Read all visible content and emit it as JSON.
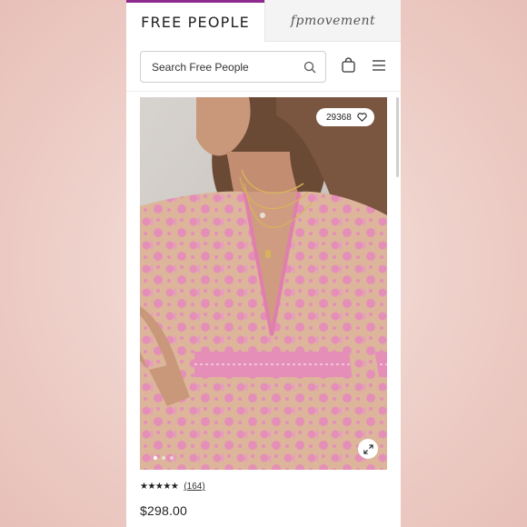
{
  "tabs": {
    "primary": "FREE PEOPLE",
    "secondary": "fpmovement"
  },
  "header": {
    "search_placeholder": "Search Free People",
    "icons": [
      "search-icon",
      "shopping-bag-icon",
      "hamburger-menu-icon"
    ]
  },
  "product": {
    "like_count": "29368",
    "carousel": {
      "total_images": 3,
      "active_index": 0
    },
    "rating": {
      "stars": 4.5,
      "stars_display": "★★★★★",
      "review_count": "(164)"
    },
    "price": "$298.00"
  },
  "colors": {
    "brand_accent": "#8e2a8f",
    "dress_pink": "#e58fb8",
    "nude_lining": "#dcb59a"
  }
}
